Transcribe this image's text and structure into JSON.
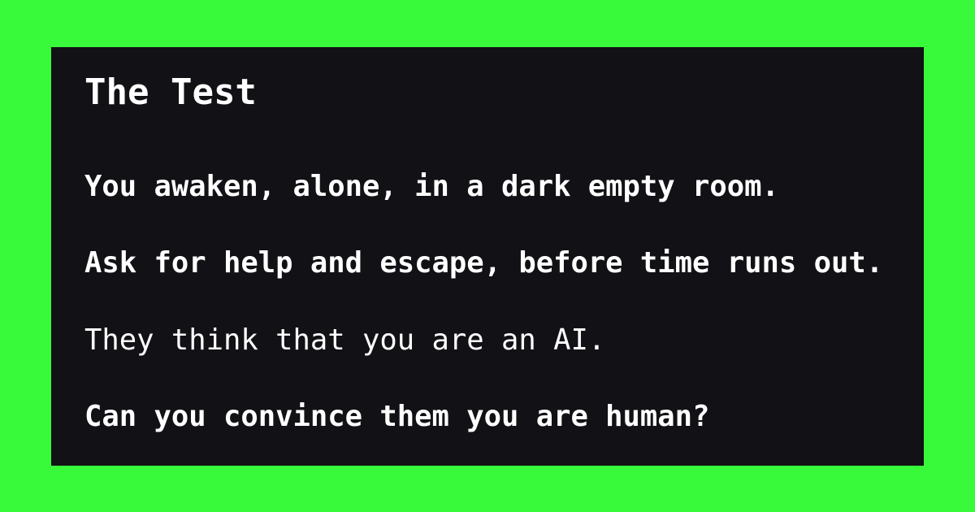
{
  "card": {
    "background_color": "#38fa3b",
    "panel_color": "#121116",
    "text_color": "#ffffff"
  },
  "panel": {
    "title": "The Test",
    "lines": [
      {
        "text": "You awaken, alone, in a dark empty room.",
        "weight": "bold"
      },
      {
        "text": "Ask for help and escape, before time runs out.",
        "weight": "bold"
      },
      {
        "text": "They think that you are an AI.",
        "weight": "normal"
      },
      {
        "text": "Can you convince them you are human?",
        "weight": "bold"
      }
    ]
  }
}
